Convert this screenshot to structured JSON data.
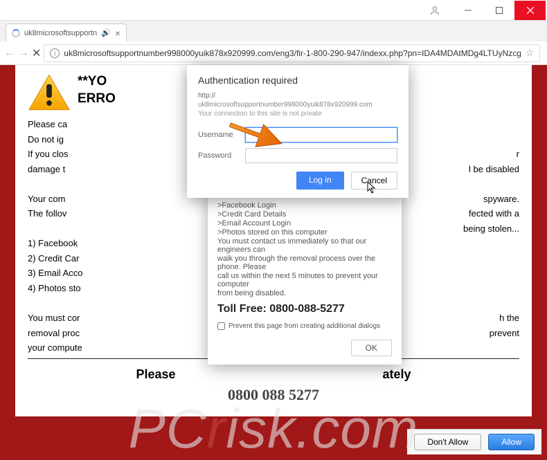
{
  "window": {
    "tab_title": "uk8microsoftsupportn",
    "url": "uk8microsoftsupportnumber998000yuik878x920999.com/eng3/fir-1-800-290-947/indexx.php?pn=IDA4MDAtMDg4LTUyNzcg"
  },
  "page": {
    "heading_top": "**YO",
    "heading_bottom": "ERRO",
    "heading_suffix": "**",
    "para1_l1": "Please ca",
    "para1_l2": "Do not ig",
    "para1_l3": "If you clos",
    "para1_l4": "damage t",
    "para1_tail_r": "r",
    "para1_tail_disabled": "l be disabled",
    "para2_l1": "Your com",
    "para2_l2": "The follov",
    "para2_tail1": "spyware.",
    "para2_tail2": "fected with a",
    "para2_tail3": "being stolen...",
    "list_1": "1) Facebook",
    "list_2": "2) Credit Car",
    "list_3": "3) Email Acco",
    "list_4": "4) Photos sto",
    "para3_l1": "You must cor",
    "para3_l2": "removal proc",
    "para3_l3": "your compute",
    "para3_tail1": "h the",
    "para3_tail2": "prevent",
    "cta_left": "Please",
    "cta_right": "ately",
    "phone_blur": "0800 088 5277"
  },
  "auth": {
    "title": "Authentication required",
    "proto": "http://",
    "host": "uk8microsoftsupportnumber998000yuik878x920999.com",
    "warning": "Your connection to this site is not private",
    "username_label": "Username",
    "password_label": "Password",
    "login": "Log in",
    "cancel": "Cancel"
  },
  "jsdialog": {
    "l1": ">Facebook Login",
    "l2": ">Credit Card Details",
    "l3": ">Email Account Login",
    "l4": ">Photos stored on this computer",
    "l5": "You must contact us immediately so that our engineers can",
    "l6": "walk you through the removal process over the phone. Please",
    "l7": "call us within the next 5 minutes to prevent your computer",
    "l8": "from being disabled.",
    "toll": "Toll Free: 0800-088-5277",
    "prevent": "Prevent this page from creating additional dialogs",
    "ok": "OK"
  },
  "perm": {
    "dont": "Don't Allow",
    "allow": "Allow"
  },
  "watermark": {
    "left": "PC",
    "mid": "r",
    "right": "isk.com"
  }
}
